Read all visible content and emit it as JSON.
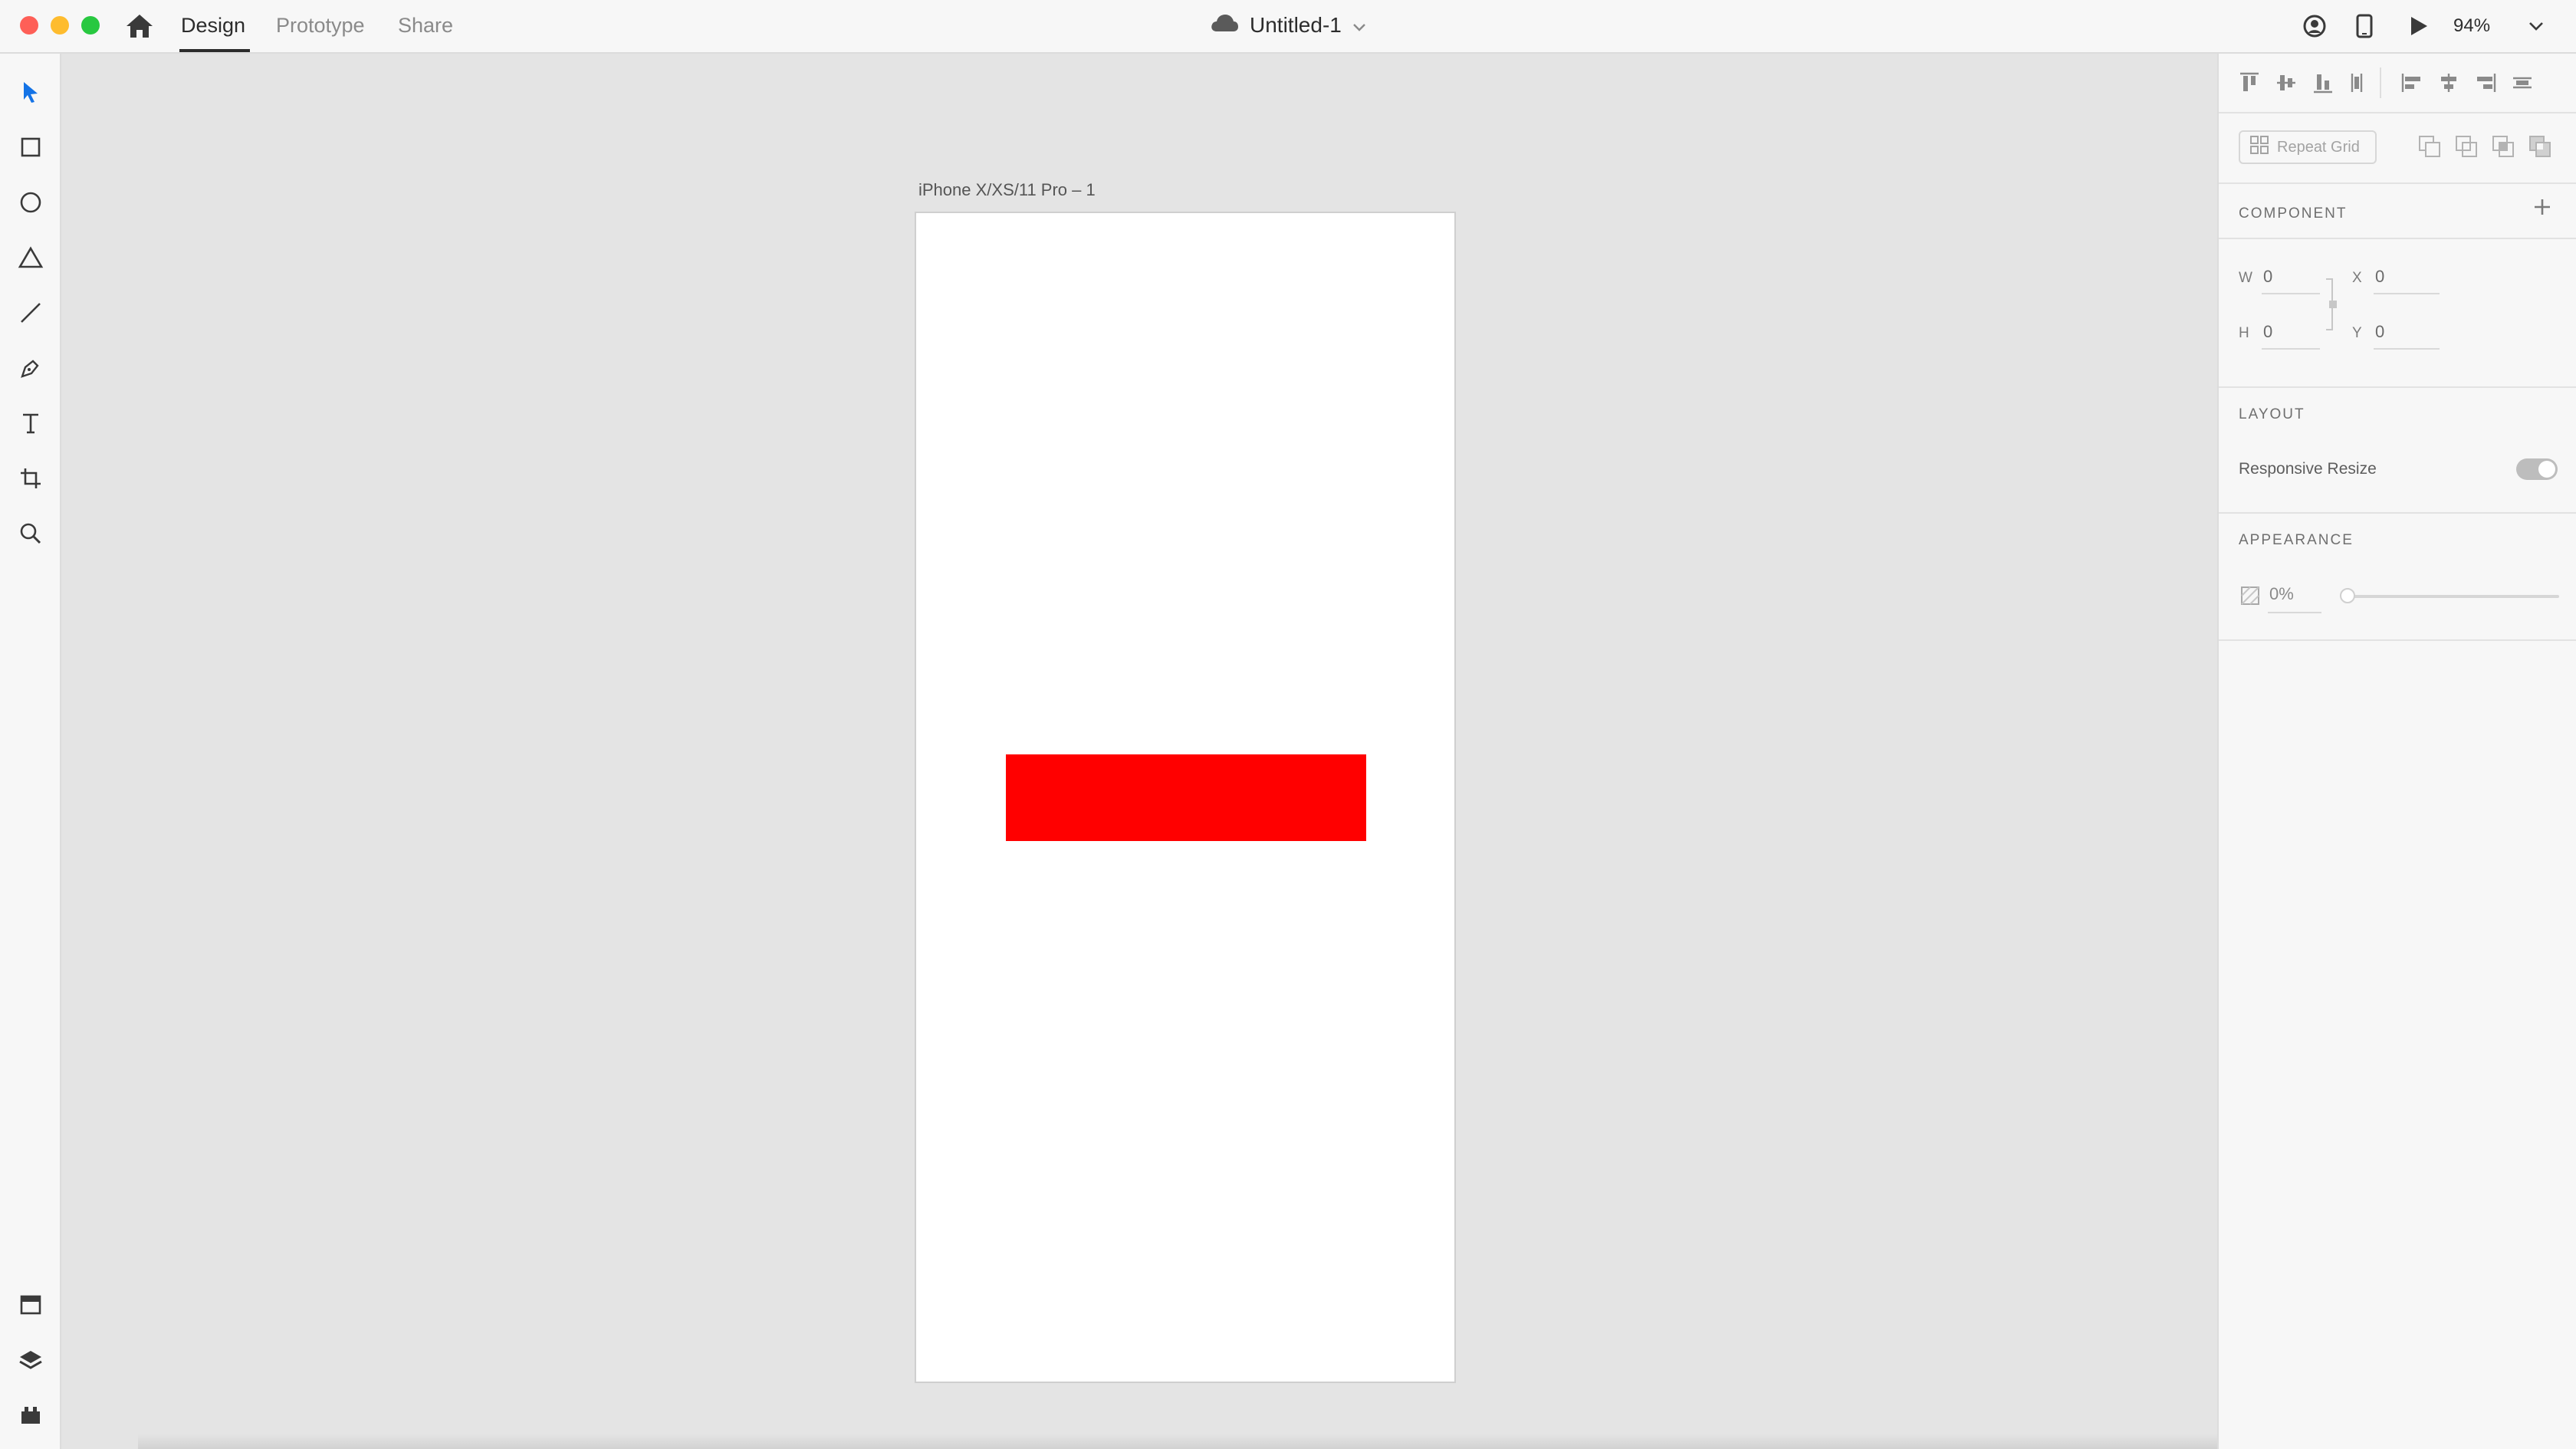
{
  "window": {
    "doc_title": "Untitled-1",
    "zoom": "94%"
  },
  "tabs": [
    {
      "label": "Design",
      "active": true
    },
    {
      "label": "Prototype",
      "active": false
    },
    {
      "label": "Share",
      "active": false
    }
  ],
  "canvas": {
    "artboard_name": "iPhone X/XS/11 Pro – 1",
    "shape_fill": "#ff0000"
  },
  "left_tools": [
    "select-tool",
    "rectangle-tool",
    "ellipse-tool",
    "polygon-tool",
    "line-tool",
    "pen-tool",
    "text-tool",
    "artboard-tool",
    "zoom-tool"
  ],
  "bottom_tools": [
    "assets-panel",
    "layers-panel",
    "plugins-panel"
  ],
  "right_panel": {
    "repeat_grid_label": "Repeat Grid",
    "component_title": "COMPONENT",
    "transform": {
      "w_label": "W",
      "w_value": "0",
      "h_label": "H",
      "h_value": "0",
      "x_label": "X",
      "x_value": "0",
      "y_label": "Y",
      "y_value": "0"
    },
    "layout_title": "LAYOUT",
    "responsive_resize_label": "Responsive Resize",
    "appearance_title": "APPEARANCE",
    "opacity_value": "0%"
  }
}
